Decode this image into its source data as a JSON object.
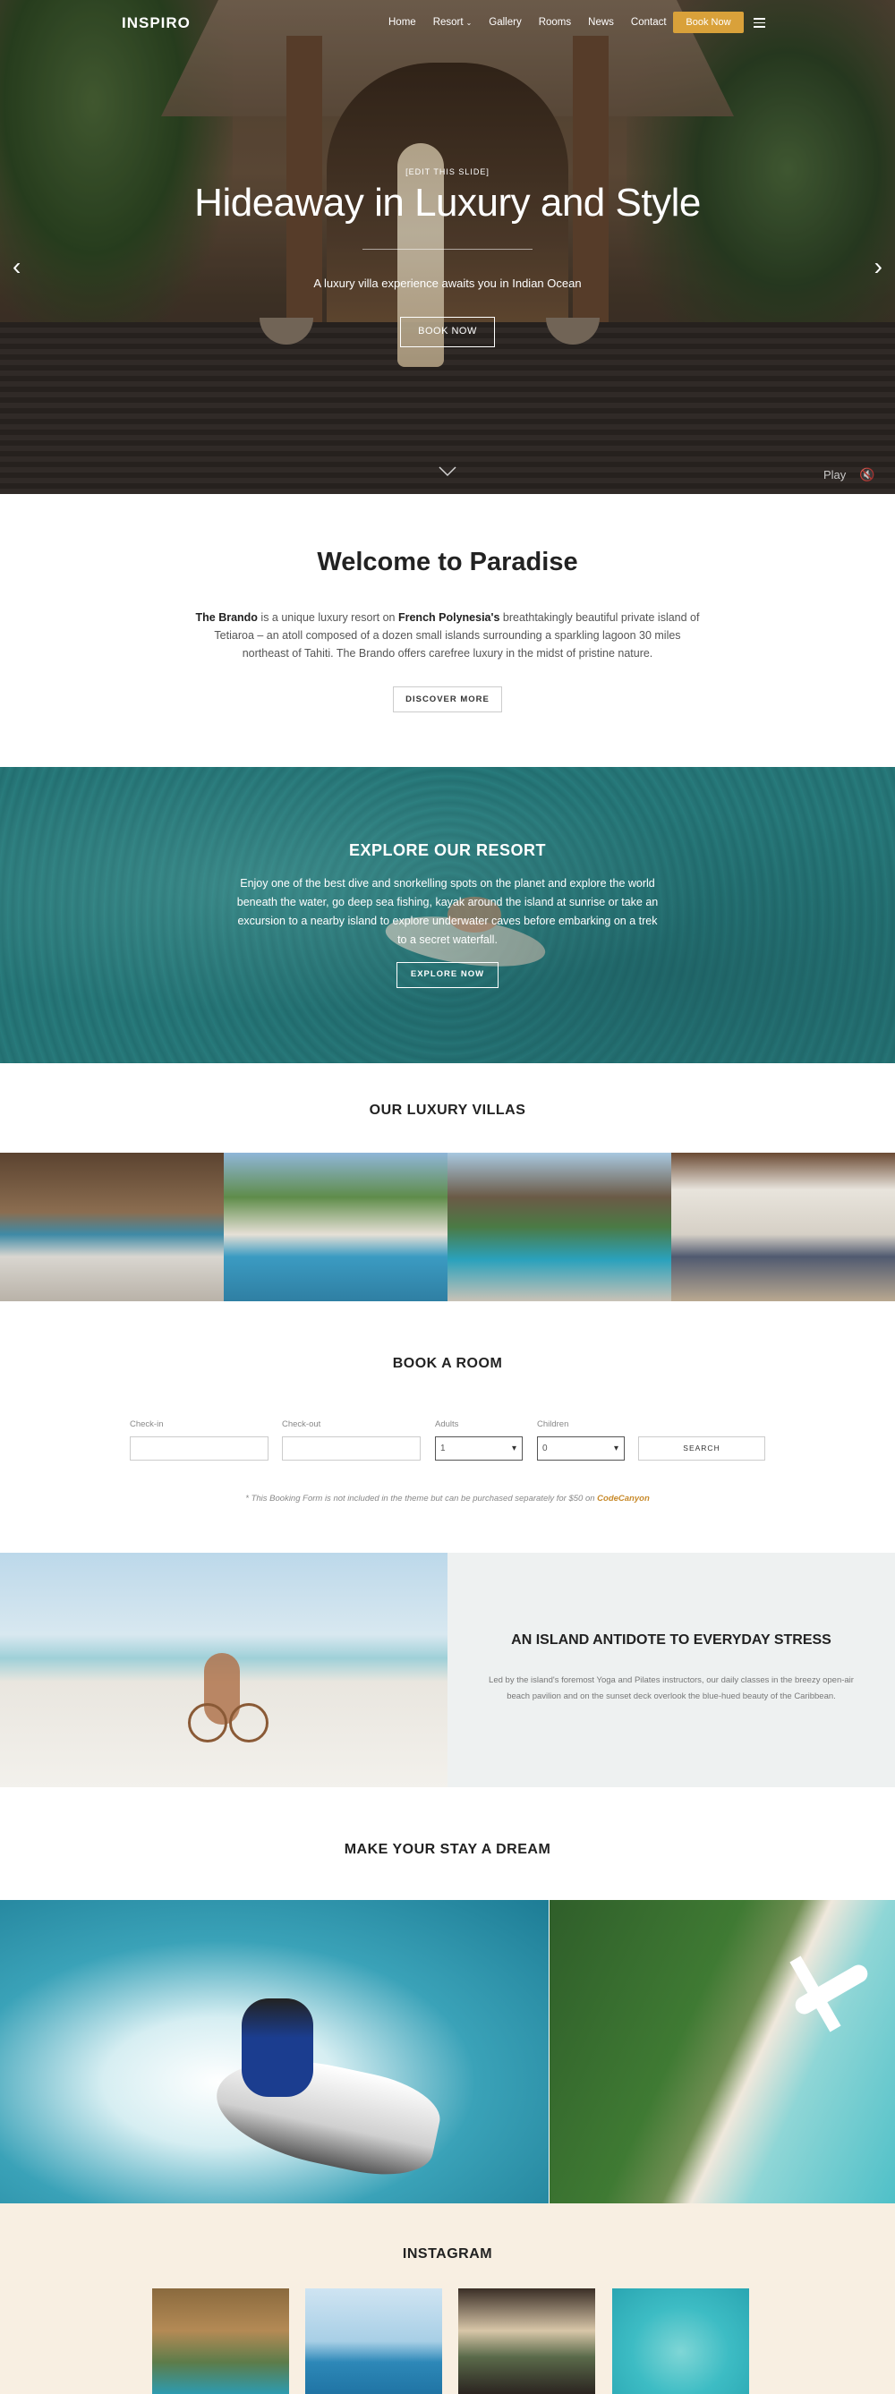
{
  "nav": {
    "logo": "INSPIRO",
    "items": [
      {
        "label": "Home"
      },
      {
        "label": "Resort",
        "has_dropdown": true
      },
      {
        "label": "Gallery"
      },
      {
        "label": "Rooms"
      },
      {
        "label": "News"
      },
      {
        "label": "Contact"
      }
    ],
    "cta": "Book Now",
    "accent_color": "#d9a13a",
    "menu_icon": "hamburger-icon"
  },
  "hero": {
    "tag": "[EDIT THIS SLIDE]",
    "title": "Hideaway in Luxury and Style",
    "subtitle": "A luxury villa experience awaits you in Indian Ocean",
    "cta": "BOOK NOW",
    "play_label": "Play",
    "prev_icon": "chevron-left-icon",
    "next_icon": "chevron-right-icon",
    "mute_icon": "speaker-muted-icon"
  },
  "welcome": {
    "title": "Welcome to Paradise",
    "text_brand": "The Brando",
    "text_1": " is a unique luxury resort on ",
    "text_place": "French Polynesia's",
    "text_2": " breathtakingly beautiful private island of Tetiaroa – an atoll composed of a dozen small islands surrounding a sparkling lagoon 30 miles northeast of Tahiti. The Brando offers carefree luxury in the midst of pristine nature.",
    "cta": "DISCOVER MORE"
  },
  "explore": {
    "title": "EXPLORE OUR RESORT",
    "text": "Enjoy one of the best dive and snorkelling spots on the planet and explore the world beneath the water, go deep sea fishing, kayak around the island at sunrise or take an excursion to a nearby island to explore underwater caves before embarking on a trek to a secret waterfall.",
    "cta": "EXPLORE NOW"
  },
  "villas": {
    "title": "OUR LUXURY VILLAS"
  },
  "booking": {
    "title": "BOOK A ROOM",
    "fields": {
      "checkin_label": "Check-in",
      "checkout_label": "Check-out",
      "adults_label": "Adults",
      "adults_value": "1",
      "children_label": "Children",
      "children_value": "0"
    },
    "search": "SEARCH",
    "note": "* This Booking Form is not included in the theme but can be purchased separately for $50 on ",
    "note_link": "CodeCanyon",
    "link_color": "#c88a2a"
  },
  "island": {
    "title": "AN ISLAND ANTIDOTE TO EVERYDAY STRESS",
    "text": "Led by the island's foremost Yoga and Pilates instructors, our daily classes in the breezy open-air beach pavilion and on the sunset deck overlook the blue-hued beauty of the Caribbean."
  },
  "dream": {
    "title": "MAKE YOUR STAY A DREAM"
  },
  "instagram": {
    "title": "INSTAGRAM"
  }
}
